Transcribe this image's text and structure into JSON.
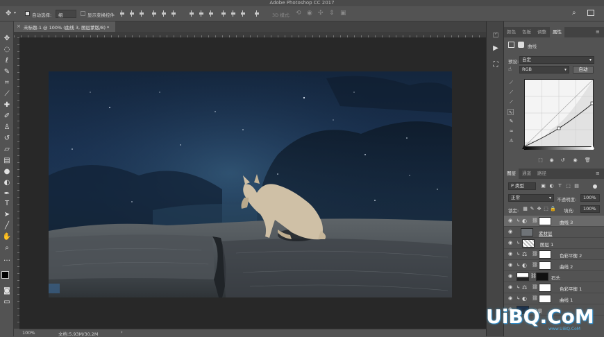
{
  "app": {
    "title": "Adobe Photoshop CC 2017"
  },
  "options": {
    "auto_select_label": "自动选择:",
    "auto_select_value": "组",
    "show_transform_label": "显示变换控件",
    "mode_3d_label": "3D 模式:"
  },
  "document": {
    "tab_label": "未标题-1 @ 100% (曲线 3, 图层蒙版/8) *",
    "close_glyph": "×"
  },
  "status": {
    "zoom": "100%",
    "doc_size": "文档:5.93M/30.2M"
  },
  "props_panel": {
    "tabs": [
      "颜色",
      "色板",
      "调整",
      "属性"
    ],
    "active_tab": 3,
    "header_label": "曲线",
    "preset_label": "预设:",
    "preset_value": "自定",
    "channel_value": "RGB",
    "auto_button": "自动"
  },
  "layers_panel": {
    "tabs": [
      "图层",
      "通道",
      "路径"
    ],
    "kind_value": "P 类型",
    "blend_mode": "正常",
    "opacity_label": "不透明度:",
    "opacity_value": "100%",
    "lock_label": "锁定:",
    "fill_label": "填充:",
    "fill_value": "100%",
    "layers": [
      {
        "name": "曲线 3",
        "active": true
      },
      {
        "name": "素材层",
        "active": false
      },
      {
        "name": "图层 1",
        "active": false
      },
      {
        "name": "色彩平衡 2",
        "active": false
      },
      {
        "name": "曲线 2",
        "active": false
      },
      {
        "name": "石头",
        "active": false
      },
      {
        "name": "色彩平衡 1",
        "active": false
      },
      {
        "name": "曲线 1",
        "active": false
      },
      {
        "name": "背景",
        "active": false
      }
    ]
  },
  "watermark": {
    "text": "UiBQ.CoM",
    "sub": "www.UiBQ.CoM"
  },
  "colors": {
    "canvas_sky": "#1a3150",
    "panel_bg": "#535353",
    "pasteboard": "#282828"
  }
}
